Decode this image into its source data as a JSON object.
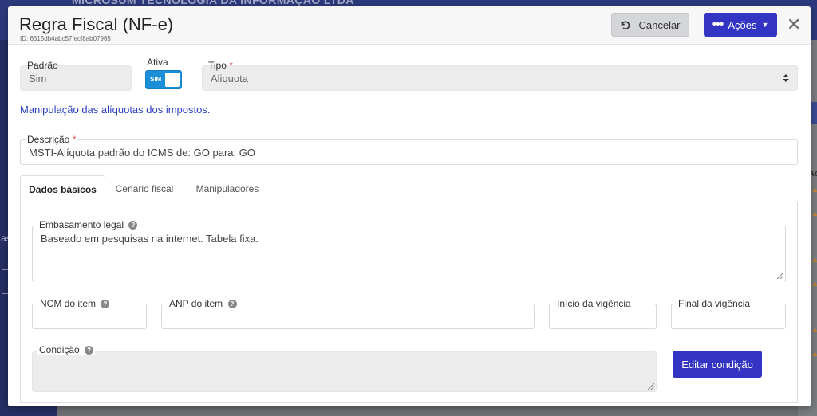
{
  "background": {
    "company_name": "MICROSUM TECNOLOGIA DA INFORMAÇÃO LTDA",
    "sidebar_fragment": "as",
    "right_fragment": "Ac"
  },
  "modal": {
    "title": "Regra Fiscal (NF-e)",
    "id_text": "ID: 6515db4abc57fecf8ab07965",
    "cancel_label": "Cancelar",
    "actions_label": "Ações",
    "close_glyph": "✕"
  },
  "fields": {
    "padrao": {
      "label": "Padrão",
      "value": "Sim"
    },
    "ativa": {
      "label": "Ativa",
      "toggle_text": "SIM"
    },
    "tipo": {
      "label": "Tipo",
      "required": "*",
      "value": "Aliquota"
    },
    "info_link": "Manipulação das alíquotas dos impostos.",
    "descricao": {
      "label": "Descrição",
      "required": "*",
      "value": "MSTI-Alíquota padrão do ICMS de: GO para: GO"
    }
  },
  "tabs": [
    {
      "label": "Dados básicos",
      "active": true
    },
    {
      "label": "Cenário fiscal",
      "active": false
    },
    {
      "label": "Manipuladores",
      "active": false
    }
  ],
  "panel": {
    "embasamento": {
      "label": "Embasamento legal",
      "value": "Baseado em pesquisas na internet. Tabela fixa."
    },
    "ncm": {
      "label": "NCM do item",
      "value": ""
    },
    "anp": {
      "label": "ANP do item",
      "value": ""
    },
    "inicio": {
      "label": "Início da vigência",
      "value": ""
    },
    "final": {
      "label": "Final da vigência",
      "value": ""
    },
    "condicao": {
      "label": "Condição",
      "value": ""
    },
    "edit_button": "Editar condição"
  },
  "colors": {
    "primary": "#3333c4",
    "toggle_on": "#1a8fd8",
    "link": "#2c3fc4",
    "required": "#d9534f"
  }
}
